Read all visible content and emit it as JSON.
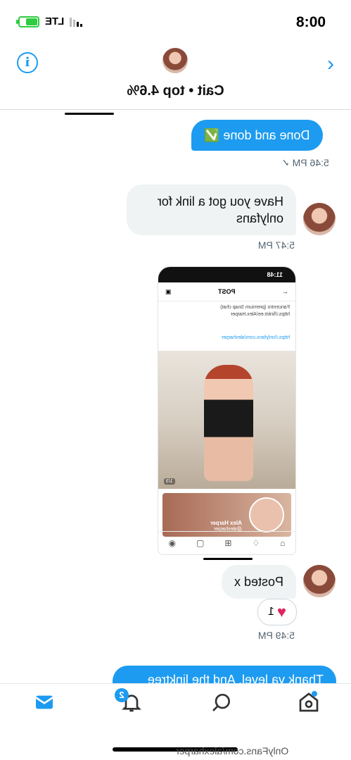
{
  "status": {
    "time": "00:8",
    "network": "LTE"
  },
  "header": {
    "contact_name": "Cait • top 4.6%"
  },
  "messages": {
    "m1": {
      "text": "Done and done ✅",
      "time": "5:46 PM ✓"
    },
    "m2": {
      "text": "Have you got a link for onlyfans",
      "time": "5:47 PM"
    },
    "screenshot": {
      "status_time": "11:48",
      "post_label": "POST",
      "desc": "Fancentro (premium Snap chat) https://linktr.ee/Alex.Harper",
      "link": "https://onlyfans.com/alexharper",
      "photo_counter": "1/3",
      "card_name": "Alex Harper",
      "card_handle": "@alexharper"
    },
    "m3": {
      "text": "Posted x",
      "reaction_count": "1",
      "time": "5:49 PM"
    },
    "m4_partial": {
      "text": "Thank ya level. And the linktree"
    }
  },
  "tabbar": {
    "notifications_badge": "2"
  },
  "watermark": "OnlyFans.com/alexharper",
  "colors": {
    "accent": "#1d9bf0",
    "bubble_received": "#eff3f4",
    "heart": "#e0245e"
  }
}
